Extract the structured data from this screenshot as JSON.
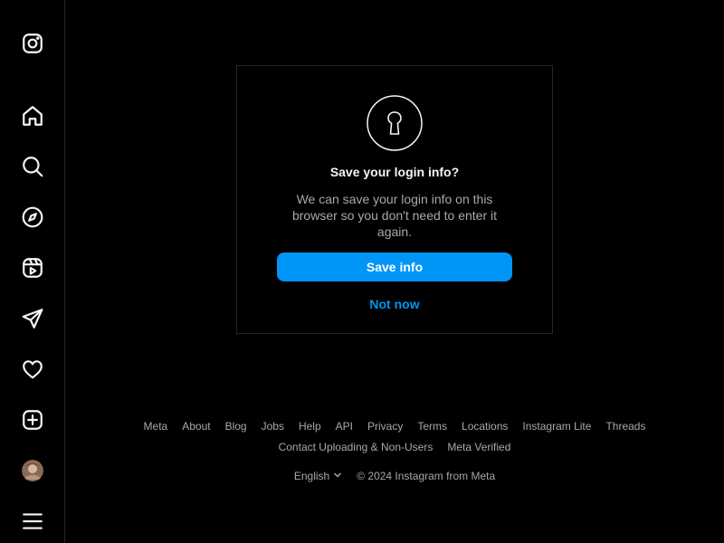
{
  "sidebar": {
    "icons": [
      {
        "name": "instagram-logo-icon"
      },
      {
        "name": "home-icon"
      },
      {
        "name": "search-icon"
      },
      {
        "name": "explore-icon"
      },
      {
        "name": "reels-icon"
      },
      {
        "name": "messages-icon"
      },
      {
        "name": "notifications-icon"
      },
      {
        "name": "create-icon"
      },
      {
        "name": "profile-avatar"
      },
      {
        "name": "menu-icon"
      }
    ]
  },
  "dialog": {
    "title": "Save your login info?",
    "description": "We can save your login info on this browser so you don't need to enter it again.",
    "save_label": "Save info",
    "not_now_label": "Not now"
  },
  "footer": {
    "row1": [
      "Meta",
      "About",
      "Blog",
      "Jobs",
      "Help",
      "API",
      "Privacy",
      "Terms",
      "Locations",
      "Instagram Lite",
      "Threads"
    ],
    "row2": [
      "Contact Uploading & Non-Users",
      "Meta Verified"
    ],
    "language": "English",
    "copyright": "© 2024 Instagram from Meta"
  },
  "colors": {
    "background": "#000000",
    "accent": "#0095f6",
    "secondary_text": "#a8a8a8",
    "border": "#262626"
  }
}
